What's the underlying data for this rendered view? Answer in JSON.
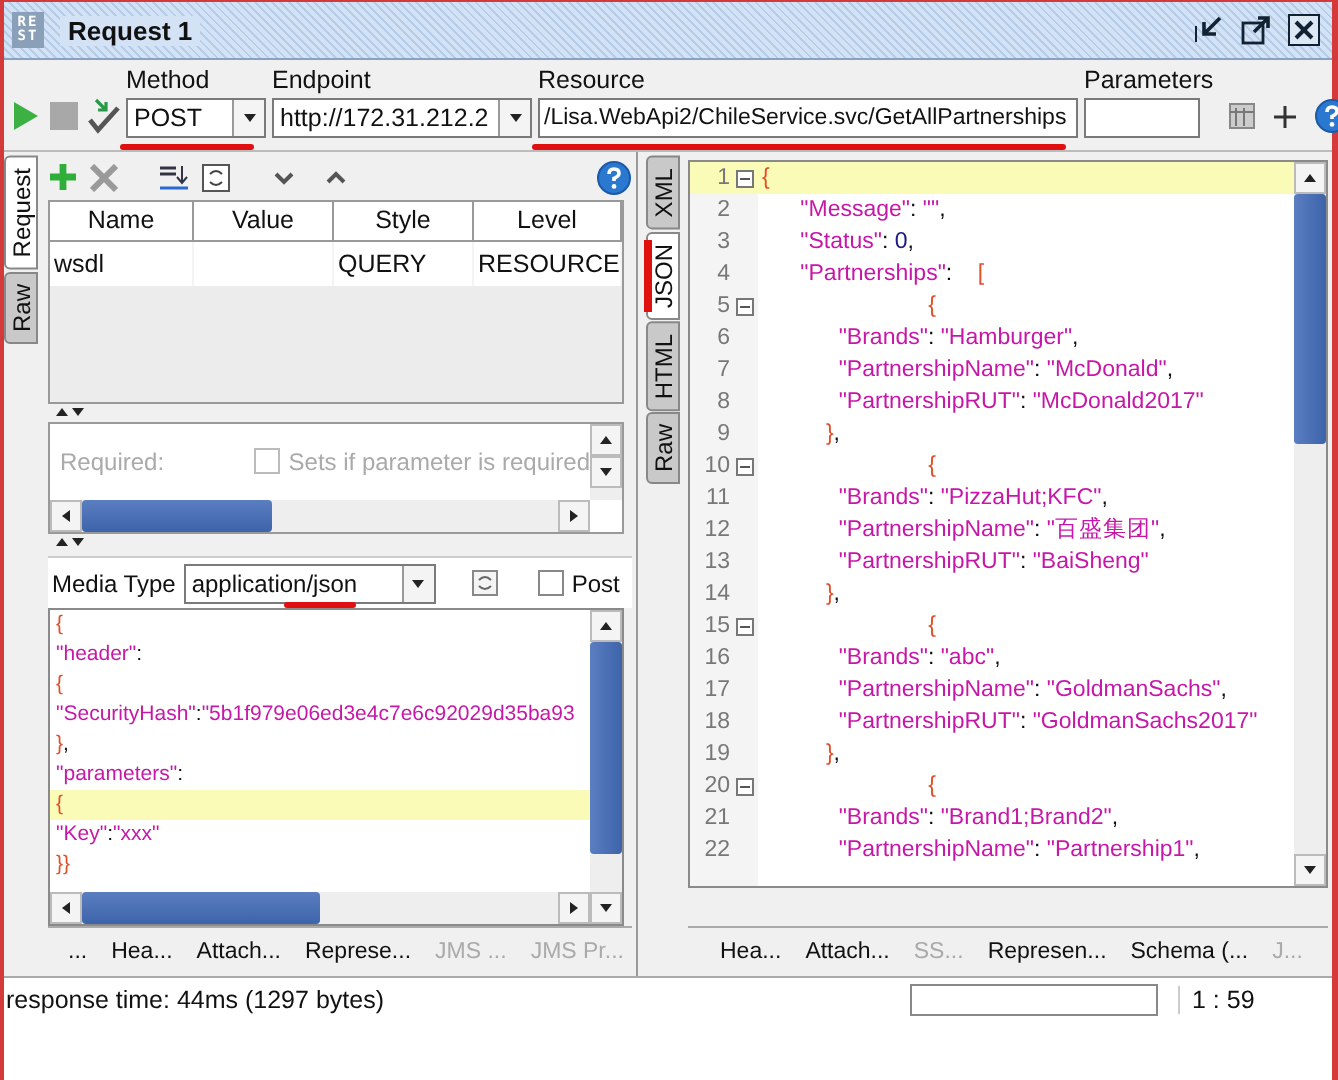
{
  "window": {
    "icon_label": "REST",
    "title": "Request 1"
  },
  "toolbar": {
    "fields": [
      {
        "kind": "select",
        "label": "Method",
        "value": "POST",
        "underlined": true
      },
      {
        "kind": "select",
        "label": "Endpoint",
        "value": "http://172.31.212.2",
        "underlined": false
      },
      {
        "kind": "input",
        "label": "Resource",
        "value": "/Lisa.WebApi2/ChileService.svc/GetAllPartnerships",
        "underlined": true
      },
      {
        "kind": "input",
        "label": "Parameters",
        "underlined": false
      }
    ]
  },
  "request_panel": {
    "side_tabs": [
      {
        "label": "Request",
        "selected": true,
        "underlined": false
      },
      {
        "label": "Raw",
        "selected": false,
        "underlined": false
      }
    ],
    "params_table": {
      "columns": [
        "Name",
        "Value",
        "Style",
        "Level"
      ],
      "rows": [
        {
          "name": "wsdl",
          "style": "QUERY",
          "level": "RESOURCE"
        }
      ]
    },
    "param_detail": {
      "label": "Required:",
      "checkbox_label": "Sets if parameter is required",
      "checked": false,
      "disabled": true
    },
    "media_type": {
      "label": "Media Type",
      "value": "application/json",
      "underlined": true
    },
    "post_query": {
      "label": "Post",
      "checked": false
    },
    "body": [
      {
        "text": "{",
        "highlighted": false
      },
      {
        "text": "\"header\":",
        "highlighted": false
      },
      {
        "text": "{",
        "highlighted": false
      },
      {
        "text": "\"SecurityHash\":\"5b1f979e06ed3e4c7e6c92029d35ba93",
        "highlighted": false
      },
      {
        "text": "},",
        "highlighted": false
      },
      {
        "text": "\"parameters\":",
        "highlighted": false
      },
      {
        "text": "{",
        "highlighted": true
      },
      {
        "text": "\"Key\":\"xxx\"",
        "highlighted": false
      },
      {
        "text": "}}",
        "highlighted": false
      }
    ],
    "bottom_tabs": [
      {
        "label": "...",
        "disabled": false
      },
      {
        "label": "Hea...",
        "disabled": false
      },
      {
        "label": "Attach...",
        "disabled": false
      },
      {
        "label": "Represe...",
        "disabled": false
      },
      {
        "label": "JMS ...",
        "disabled": true
      },
      {
        "label": "JMS Pr...",
        "disabled": true
      }
    ]
  },
  "response_panel": {
    "side_tabs": [
      {
        "label": "XML",
        "selected": false,
        "underlined": false
      },
      {
        "label": "JSON",
        "selected": true,
        "underlined": true
      },
      {
        "label": "HTML",
        "selected": false,
        "underlined": false
      },
      {
        "label": "Raw",
        "selected": false,
        "underlined": false
      }
    ],
    "lines": [
      {
        "number": "1",
        "text": "{",
        "foldable": true,
        "highlighted": true
      },
      {
        "number": "2",
        "text": "      \"Message\": \"\",",
        "foldable": false,
        "highlighted": false
      },
      {
        "number": "3",
        "text": "      \"Status\": 0,",
        "foldable": false,
        "highlighted": false
      },
      {
        "number": "4",
        "text": "      \"Partnerships\":    [",
        "foldable": false,
        "highlighted": false
      },
      {
        "number": "5",
        "text": "                          {",
        "foldable": true,
        "highlighted": false
      },
      {
        "number": "6",
        "text": "            \"Brands\": \"Hamburger\",",
        "foldable": false,
        "highlighted": false
      },
      {
        "number": "7",
        "text": "            \"PartnershipName\": \"McDonald\",",
        "foldable": false,
        "highlighted": false
      },
      {
        "number": "8",
        "text": "            \"PartnershipRUT\": \"McDonald2017\"",
        "foldable": false,
        "highlighted": false
      },
      {
        "number": "9",
        "text": "          },",
        "foldable": false,
        "highlighted": false
      },
      {
        "number": "10",
        "text": "                          {",
        "foldable": true,
        "highlighted": false
      },
      {
        "number": "11",
        "text": "            \"Brands\": \"PizzaHut;KFC\",",
        "foldable": false,
        "highlighted": false
      },
      {
        "number": "12",
        "text": "            \"PartnershipName\": \"百盛集团\",",
        "foldable": false,
        "highlighted": false
      },
      {
        "number": "13",
        "text": "            \"PartnershipRUT\": \"BaiSheng\"",
        "foldable": false,
        "highlighted": false
      },
      {
        "number": "14",
        "text": "          },",
        "foldable": false,
        "highlighted": false
      },
      {
        "number": "15",
        "text": "                          {",
        "foldable": true,
        "highlighted": false
      },
      {
        "number": "16",
        "text": "            \"Brands\": \"abc\",",
        "foldable": false,
        "highlighted": false
      },
      {
        "number": "17",
        "text": "            \"PartnershipName\": \"GoldmanSachs\",",
        "foldable": false,
        "highlighted": false
      },
      {
        "number": "18",
        "text": "            \"PartnershipRUT\": \"GoldmanSachs2017\"",
        "foldable": false,
        "highlighted": false
      },
      {
        "number": "19",
        "text": "          },",
        "foldable": false,
        "highlighted": false
      },
      {
        "number": "20",
        "text": "                          {",
        "foldable": true,
        "highlighted": false
      },
      {
        "number": "21",
        "text": "            \"Brands\": \"Brand1;Brand2\",",
        "foldable": false,
        "highlighted": false
      },
      {
        "number": "22",
        "text": "            \"PartnershipName\": \"Partnership1\",",
        "foldable": false,
        "highlighted": false
      }
    ],
    "bottom_tabs": [
      {
        "label": "Hea...",
        "disabled": false
      },
      {
        "label": "Attach...",
        "disabled": false
      },
      {
        "label": "SS...",
        "disabled": true
      },
      {
        "label": "Represen...",
        "disabled": false
      },
      {
        "label": "Schema (...",
        "disabled": false
      },
      {
        "label": "J...",
        "disabled": true
      }
    ]
  },
  "status_bar": {
    "text": "response time: 44ms (1297 bytes)",
    "progress": {
      "level": 0
    },
    "position": "1 : 59"
  }
}
